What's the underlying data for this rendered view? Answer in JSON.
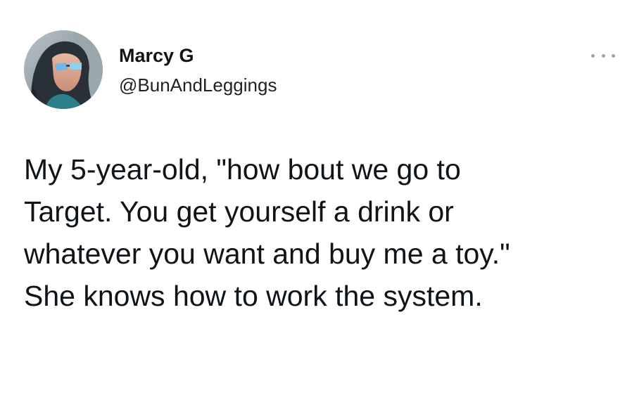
{
  "author": {
    "display_name": "Marcy G",
    "handle": "@BunAndLeggings",
    "avatar_icon": "profile-photo"
  },
  "menu": {
    "icon": "more-options-icon"
  },
  "tweet": {
    "lines": [
      "My 5-year-old, \"how bout we go to",
      "Target. You get yourself a drink or",
      "whatever you want and buy me a toy.\"",
      "She knows how to work the system."
    ]
  },
  "colors": {
    "text": "#0f1419",
    "handle": "#222222",
    "menu_dots": "#9aa5af",
    "background": "#ffffff"
  }
}
